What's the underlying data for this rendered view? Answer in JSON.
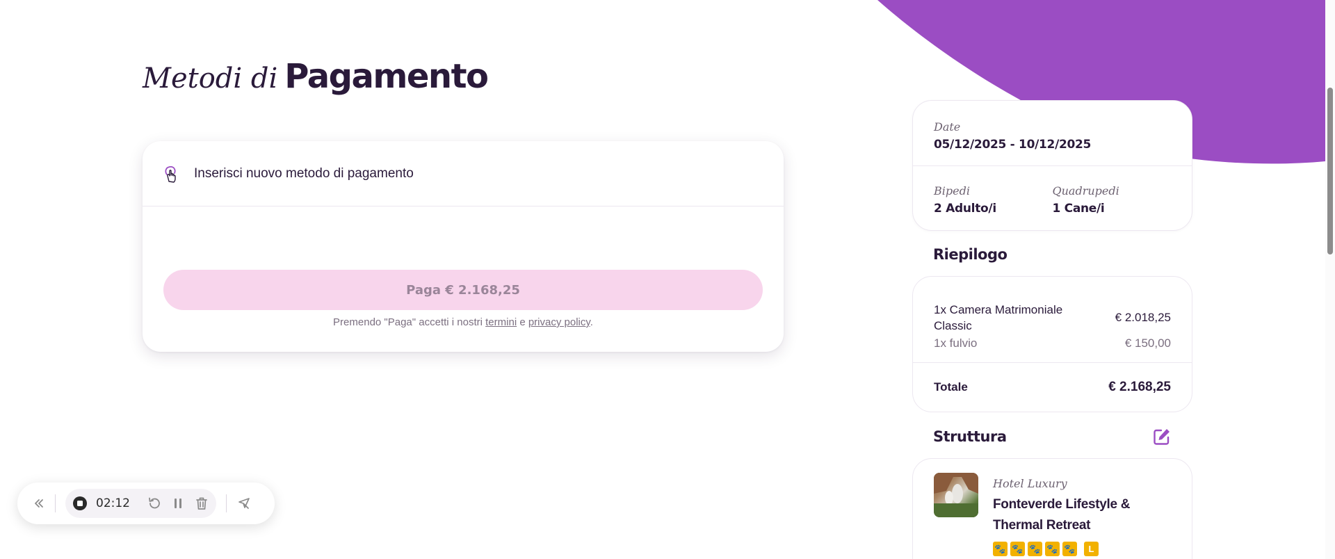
{
  "colors": {
    "brand_purple": "#9b4dc3",
    "dark_text": "#2a1a3a",
    "pay_button_bg": "#f8d5ec",
    "paw_yellow": "#f2b100"
  },
  "page": {
    "title_italic": "Metodi di",
    "title_bold": "Pagamento"
  },
  "payment": {
    "method_icon": "hand-pointer-icon",
    "method_label": "Inserisci nuovo metodo di pagamento",
    "pay_button_label": "Paga € 2.168,25",
    "terms_prefix": "Premendo \"Paga\" accetti i nostri",
    "terms_link": "termini",
    "terms_and": "e",
    "privacy_link": "privacy policy",
    "terms_suffix": "."
  },
  "booking": {
    "date_label": "Date",
    "date_value": "05/12/2025 - 10/12/2025",
    "bipedi_label": "Bipedi",
    "bipedi_value": "2 Adulto/i",
    "quadrupedi_label": "Quadrupedi",
    "quadrupedi_value": "1 Cane/i"
  },
  "summary": {
    "title": "Riepilogo",
    "items": [
      {
        "name": "1x Camera Matrimoniale Classic",
        "price": "€ 2.018,25"
      },
      {
        "name": "1x fulvio",
        "price": "€ 150,00"
      }
    ],
    "total_label": "Totale",
    "total_value": "€ 2.168,25"
  },
  "structure": {
    "title": "Struttura",
    "edit_icon": "edit-icon",
    "category": "Hotel Luxury",
    "name": "Fonteverde Lifestyle & Thermal Retreat",
    "paw_rating": 5,
    "luxury_badge": "L"
  },
  "recorder": {
    "time": "02:12"
  }
}
